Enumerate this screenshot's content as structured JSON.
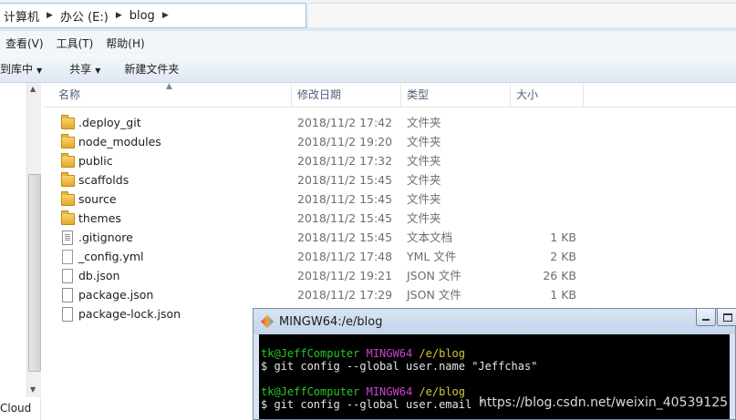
{
  "address": {
    "crumbs": [
      "计算机",
      "办公 (E:)",
      "blog"
    ]
  },
  "menu": [
    "查看(V)",
    "工具(T)",
    "帮助(H)"
  ],
  "toolbar": {
    "include_library": "到库中",
    "share": "共享",
    "new_folder": "新建文件夹"
  },
  "columns": {
    "name": "名称",
    "date": "修改日期",
    "type": "类型",
    "size": "大小"
  },
  "files": [
    {
      "name": ".deploy_git",
      "date": "2018/11/2 17:42",
      "type": "文件夹",
      "size": "",
      "icon": "folder-icon"
    },
    {
      "name": "node_modules",
      "date": "2018/11/2 19:20",
      "type": "文件夹",
      "size": "",
      "icon": "folder-icon"
    },
    {
      "name": "public",
      "date": "2018/11/2 17:32",
      "type": "文件夹",
      "size": "",
      "icon": "folder-icon"
    },
    {
      "name": "scaffolds",
      "date": "2018/11/2 15:45",
      "type": "文件夹",
      "size": "",
      "icon": "folder-icon"
    },
    {
      "name": "source",
      "date": "2018/11/2 15:45",
      "type": "文件夹",
      "size": "",
      "icon": "folder-icon"
    },
    {
      "name": "themes",
      "date": "2018/11/2 15:45",
      "type": "文件夹",
      "size": "",
      "icon": "folder-icon"
    },
    {
      "name": ".gitignore",
      "date": "2018/11/2 15:45",
      "type": "文本文档",
      "size": "1 KB",
      "icon": "text-file-icon"
    },
    {
      "name": "_config.yml",
      "date": "2018/11/2 17:48",
      "type": "YML 文件",
      "size": "2 KB",
      "icon": "config-file-icon"
    },
    {
      "name": "db.json",
      "date": "2018/11/2 19:21",
      "type": "JSON 文件",
      "size": "26 KB",
      "icon": "file-icon"
    },
    {
      "name": "package.json",
      "date": "2018/11/2 17:29",
      "type": "JSON 文件",
      "size": "1 KB",
      "icon": "file-icon"
    },
    {
      "name": "package-lock.json",
      "date": "",
      "type": "",
      "size": "",
      "icon": "file-icon"
    }
  ],
  "nav": {
    "cloud_label": "Cloud"
  },
  "terminal": {
    "title": "MINGW64:/e/blog",
    "prompt1": {
      "user": "tk@JeffComputer",
      "env": "MINGW64",
      "path": "/e/blog"
    },
    "cmd1": "$ git config --global user.name \"Jeffchas\"",
    "prompt2": {
      "user": "tk@JeffComputer",
      "env": "MINGW64",
      "path": "/e/blog"
    },
    "cmd2": "$ git config --global user.email \""
  },
  "watermark": "https://blog.csdn.net/weixin_40539125",
  "colors": {
    "prompt_user": "#25c825",
    "prompt_env": "#cc44cc",
    "prompt_path": "#d2c83a",
    "terminal_bg": "#000000"
  }
}
